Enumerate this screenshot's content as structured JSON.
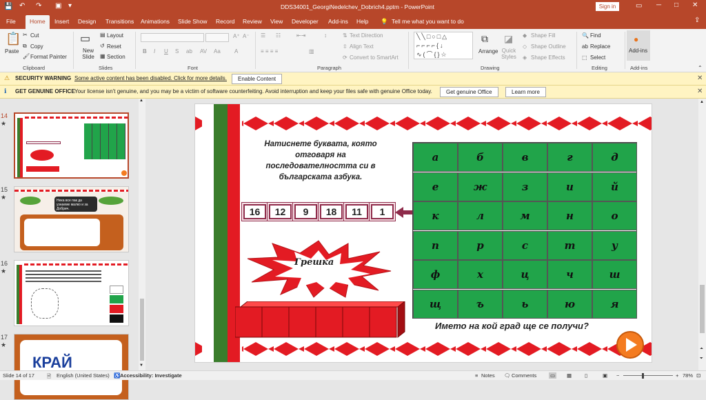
{
  "window": {
    "title": "DDS34001_GeorgiNedelchev_Dobrich4.pptm - PowerPoint",
    "signin": "Sign in"
  },
  "tabs": [
    "File",
    "Home",
    "Insert",
    "Design",
    "Transitions",
    "Animations",
    "Slide Show",
    "Record",
    "Review",
    "View",
    "Developer",
    "Add-ins",
    "Help"
  ],
  "tell_me": "Tell me what you want to do",
  "ribbon": {
    "clipboard": {
      "paste": "Paste",
      "cut": "Cut",
      "copy": "Copy",
      "format_painter": "Format Painter",
      "label": "Clipboard"
    },
    "slides": {
      "new_slide": "New Slide",
      "layout": "Layout",
      "reset": "Reset",
      "section": "Section",
      "label": "Slides"
    },
    "font": {
      "label": "Font"
    },
    "paragraph": {
      "text_direction": "Text Direction",
      "align_text": "Align Text",
      "convert": "Convert to SmartArt",
      "label": "Paragraph"
    },
    "drawing": {
      "arrange": "Arrange",
      "quick_styles": "Quick Styles",
      "shape_fill": "Shape Fill",
      "shape_outline": "Shape Outline",
      "shape_effects": "Shape Effects",
      "label": "Drawing"
    },
    "editing": {
      "find": "Find",
      "replace": "Replace",
      "select": "Select",
      "label": "Editing"
    },
    "addins": {
      "button": "Add-ins",
      "label": "Add-ins"
    }
  },
  "security_bar": {
    "title": "SECURITY WARNING",
    "message": "Some active content has been disabled. Click for more details.",
    "button": "Enable Content"
  },
  "genuine_bar": {
    "title": "GET GENUINE OFFICE",
    "message": "Your license isn't genuine, and you may be a victim of software counterfeiting. Avoid interruption and keep your files safe with genuine Office today.",
    "button1": "Get genuine Office",
    "button2": "Learn more"
  },
  "thumbnails": [
    {
      "num": "14"
    },
    {
      "num": "15",
      "caption": "Нека все пак да узнаеме малко и за Добрич."
    },
    {
      "num": "16"
    },
    {
      "num": "17",
      "text": "КРАЙ"
    }
  ],
  "slide": {
    "instruction": "Натиснете буквата, която отговаря на последователността си в българската азбука.",
    "numbers": [
      "16",
      "12",
      "9",
      "18",
      "11",
      "1"
    ],
    "error": "Грешка",
    "question": "Името на кой град ще се получи?",
    "letters": [
      "а",
      "б",
      "в",
      "г",
      "д",
      "е",
      "ж",
      "з",
      "и",
      "й",
      "к",
      "л",
      "м",
      "н",
      "о",
      "п",
      "р",
      "с",
      "т",
      "у",
      "ф",
      "х",
      "ц",
      "ч",
      "ш",
      "щ",
      "ъ",
      "ь",
      "ю",
      "я"
    ]
  },
  "status": {
    "slide": "Slide 14 of 17",
    "language": "English (United States)",
    "accessibility": "Accessibility: Investigate",
    "notes": "Notes",
    "comments": "Comments",
    "zoom": "78%"
  },
  "colors": {
    "accent": "#b7472a",
    "tile": "#21a44a",
    "red": "#e31b23"
  }
}
